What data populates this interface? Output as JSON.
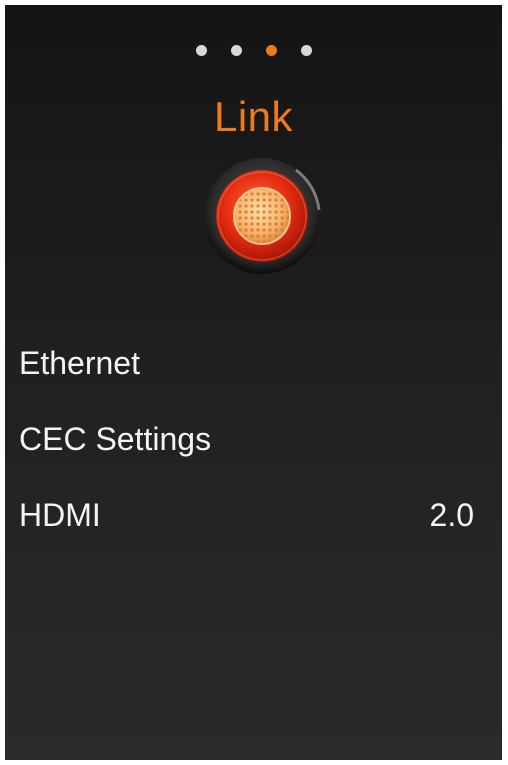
{
  "pager": {
    "dots": 4,
    "active_index": 2,
    "dot_color": "#d8d8d8",
    "active_color": "#f07a1a"
  },
  "header": {
    "title": "Link",
    "icon": "cable-connector-icon"
  },
  "menu": {
    "items": [
      {
        "label": "Ethernet",
        "value": ""
      },
      {
        "label": "CEC Settings",
        "value": ""
      },
      {
        "label": "HDMI",
        "value": "2.0"
      }
    ]
  },
  "colors": {
    "accent": "#f07a1a",
    "badge_red": "#e52c12",
    "text": "#f4f4f4"
  }
}
